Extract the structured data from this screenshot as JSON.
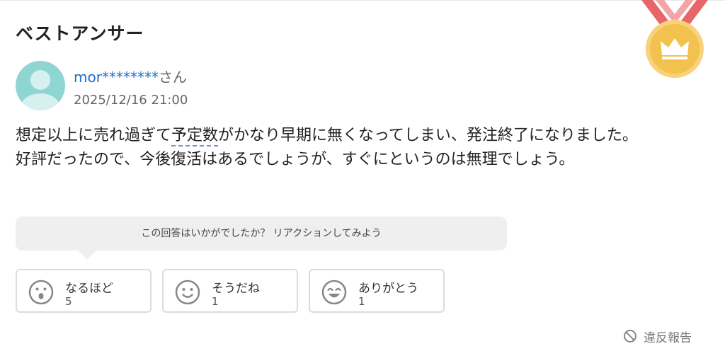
{
  "section_title": "ベストアンサー",
  "answerer": {
    "username": "mor********",
    "honorific": "さん",
    "datetime": "2025/12/16 21:00"
  },
  "answer": {
    "part1": "想定以上に売れ過ぎて",
    "keyword": "予定数",
    "part2": "がかなり早期に無くなってしまい、発注終了になりました。",
    "line2": "好評だったので、今後復活はあるでしょうが、すぐにというのは無理でしょう。"
  },
  "reaction_prompt": "この回答はいかがでしたか？ リアクションしてみよう",
  "reactions": [
    {
      "label": "なるほど",
      "count": "5",
      "icon": "surprised-face-icon"
    },
    {
      "label": "そうだね",
      "count": "1",
      "icon": "smile-face-icon"
    },
    {
      "label": "ありがとう",
      "count": "1",
      "icon": "grin-face-icon"
    }
  ],
  "report_label": "違反報告",
  "colors": {
    "username": "#1e6fd0",
    "medal_gold": "#f2c14e",
    "medal_ribbon": "#e8656a",
    "avatar_bg": "#8fd6d3"
  }
}
